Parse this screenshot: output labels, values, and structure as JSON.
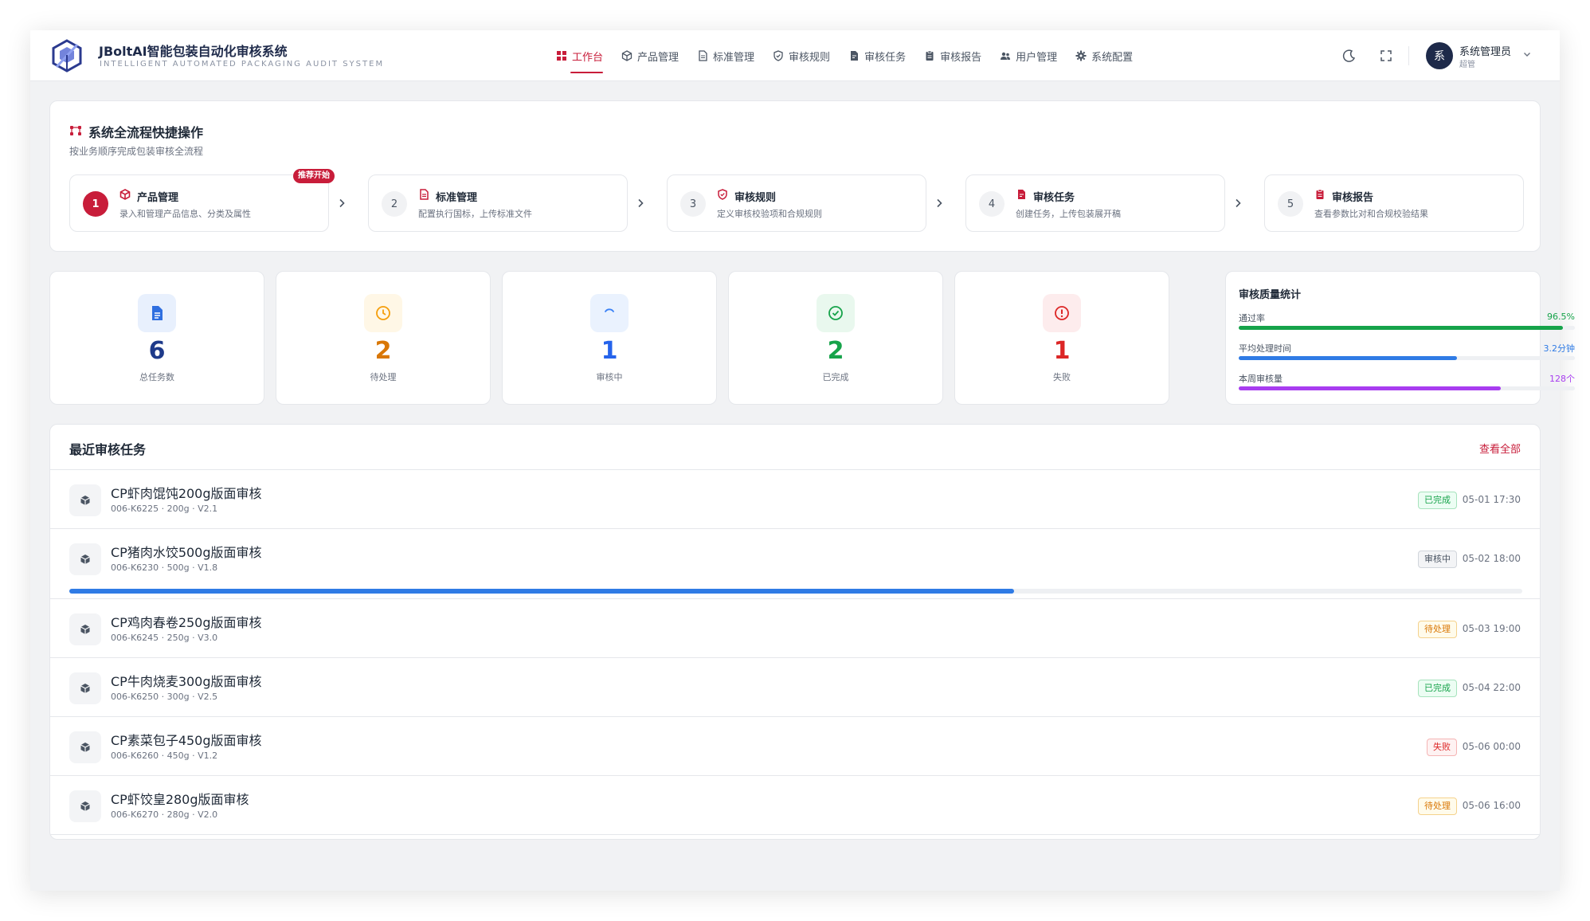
{
  "header": {
    "brand_title": "JBoltAI智能包装自动化审核系统",
    "brand_subtitle": "INTELLIGENT AUTOMATED PACKAGING AUDIT SYSTEM",
    "accent_color": "#c81d3a",
    "nav": [
      {
        "label": "工作台",
        "icon": "dashboard-icon",
        "active": true
      },
      {
        "label": "产品管理",
        "icon": "cube-icon"
      },
      {
        "label": "标准管理",
        "icon": "document-icon"
      },
      {
        "label": "审核规则",
        "icon": "shield-icon"
      },
      {
        "label": "审核任务",
        "icon": "task-file-icon"
      },
      {
        "label": "审核报告",
        "icon": "clipboard-icon"
      },
      {
        "label": "用户管理",
        "icon": "users-icon"
      },
      {
        "label": "系统配置",
        "icon": "gear-icon"
      }
    ],
    "user": {
      "avatar_text": "系",
      "name": "系统管理员",
      "role": "超管"
    }
  },
  "flow": {
    "title": "系统全流程快捷操作",
    "subtitle": "按业务顺序完成包装审核全流程",
    "badge": "推荐开始",
    "steps": [
      {
        "num": "1",
        "title": "产品管理",
        "desc": "录入和管理产品信息、分类及属性",
        "icon": "cube-icon",
        "active": true
      },
      {
        "num": "2",
        "title": "标准管理",
        "desc": "配置执行国标，上传标准文件",
        "icon": "document-icon"
      },
      {
        "num": "3",
        "title": "审核规则",
        "desc": "定义审核校验项和合规规则",
        "icon": "shield-icon"
      },
      {
        "num": "4",
        "title": "审核任务",
        "desc": "创建任务，上传包装展开稿",
        "icon": "task-file-icon"
      },
      {
        "num": "5",
        "title": "审核报告",
        "desc": "查看参数比对和合规校验结果",
        "icon": "clipboard-icon"
      }
    ]
  },
  "stats": [
    {
      "value": "6",
      "label": "总任务数",
      "icon": "file-icon",
      "color": "#1e3a8a",
      "icon_color": "#2f6fe0",
      "bg": "#e8f0fd"
    },
    {
      "value": "2",
      "label": "待处理",
      "icon": "clock-icon",
      "color": "#d97706",
      "icon_color": "#f59e0b",
      "bg": "#fff7e6"
    },
    {
      "value": "1",
      "label": "审核中",
      "icon": "spinner-icon",
      "color": "#2563eb",
      "icon_color": "#3b82f6",
      "bg": "#eaf2fe"
    },
    {
      "value": "2",
      "label": "已完成",
      "icon": "check-circle-icon",
      "color": "#16a34a",
      "icon_color": "#16a34a",
      "bg": "#e9f8ee"
    },
    {
      "value": "1",
      "label": "失败",
      "icon": "alert-circle-icon",
      "color": "#dc2626",
      "icon_color": "#dc2626",
      "bg": "#fdeced"
    }
  ],
  "quality": {
    "title": "审核质量统计",
    "rows": [
      {
        "label": "通过率",
        "value": "96.5%",
        "fraction": 0.965,
        "color": "#16a34a"
      },
      {
        "label": "平均处理时间",
        "value": "3.2分钟",
        "fraction": 0.65,
        "color": "#2f7be5"
      },
      {
        "label": "本周审核量",
        "value": "128个",
        "fraction": 0.78,
        "color": "#a83df0"
      }
    ]
  },
  "tasks": {
    "title": "最近审核任务",
    "view_all": "查看全部",
    "rows": [
      {
        "name": "CP虾肉馄饨200g版面审核",
        "meta": "006-K6225 · 200g · V2.1",
        "status": "已完成",
        "status_type": "done",
        "time": "05-01 17:30"
      },
      {
        "name": "CP猪肉水饺500g版面审核",
        "meta": "006-K6230 · 500g · V1.8",
        "status": "审核中",
        "status_type": "progress",
        "time": "05-02 18:00",
        "progress": 0.65
      },
      {
        "name": "CP鸡肉春卷250g版面审核",
        "meta": "006-K6245 · 250g · V3.0",
        "status": "待处理",
        "status_type": "pending",
        "time": "05-03 19:00"
      },
      {
        "name": "CP牛肉烧麦300g版面审核",
        "meta": "006-K6250 · 300g · V2.5",
        "status": "已完成",
        "status_type": "done",
        "time": "05-04 22:00"
      },
      {
        "name": "CP素菜包子450g版面审核",
        "meta": "006-K6260 · 450g · V1.2",
        "status": "失败",
        "status_type": "fail",
        "time": "05-06 00:00"
      },
      {
        "name": "CP虾饺皇280g版面审核",
        "meta": "006-K6270 · 280g · V2.0",
        "status": "待处理",
        "status_type": "pending",
        "time": "05-06 16:00"
      }
    ]
  }
}
